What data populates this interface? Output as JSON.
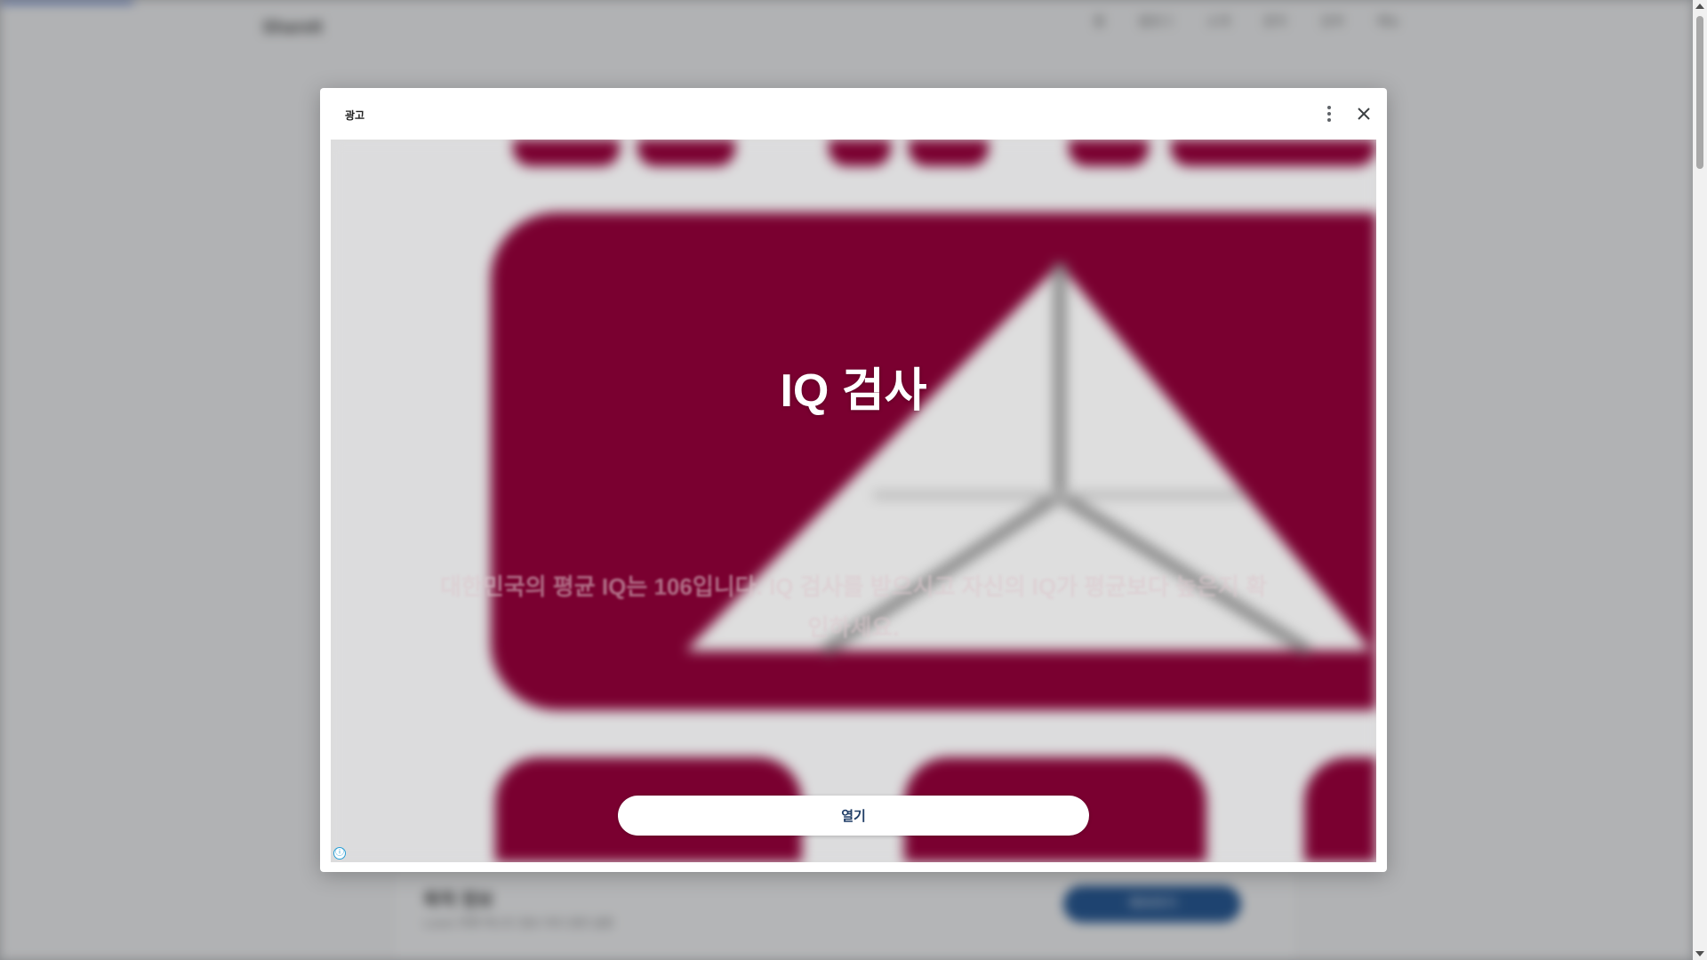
{
  "background": {
    "logo": "ShareIt",
    "nav": [
      "홈",
      "블로그",
      "소개",
      "문의",
      "검색",
      "메뉴"
    ],
    "footer_card": {
      "title": "목적 정보",
      "text": "Lorem 목록 텍스트 정보 처리 관련 설명",
      "button": "계속하기"
    }
  },
  "modal": {
    "ad_label": "광고",
    "more_icon": "more-vert-icon",
    "close_icon": "close-icon",
    "headline": "IQ 검사",
    "body": "대한민국의 평균 IQ는 106입니다. IQ 검사를 받으시고 자신의 IQ가 평균보다 높은지 확인하세요.",
    "cta": "열기",
    "info_icon": "ⓘ"
  },
  "colors": {
    "creative_primary": "#7a0030",
    "creative_bg": "#dcdcdd",
    "cta_text": "#1f3d66",
    "info_icon": "#2a9fd6"
  }
}
